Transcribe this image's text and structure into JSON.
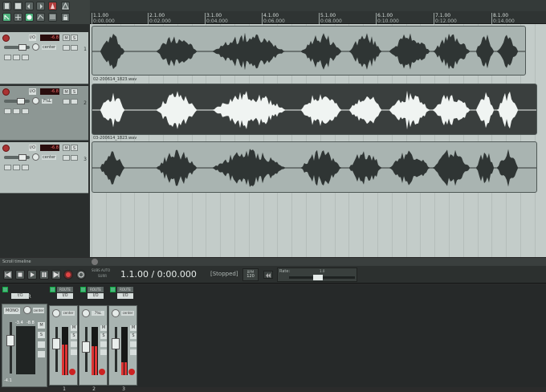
{
  "toolbar": {
    "icons": [
      "new-project-icon",
      "save-icon",
      "undo-icon",
      "redo-icon",
      "metronome-icon",
      "snap-icon",
      "ripple-icon",
      "grid-icon",
      "record-mode-icon",
      "envelope-icon",
      "lock-icon",
      "auto-crossfade-icon"
    ]
  },
  "ruler": {
    "markers": [
      {
        "bar": "1.1.00",
        "time": "0:00.000"
      },
      {
        "bar": "2.1.00",
        "time": "0:02.000"
      },
      {
        "bar": "3.1.00",
        "time": "0:04.000"
      },
      {
        "bar": "4.1.00",
        "time": "0:06.000"
      },
      {
        "bar": "5.1.00",
        "time": "0:08.000"
      },
      {
        "bar": "6.1.00",
        "time": "0:10.000"
      },
      {
        "bar": "7.1.00",
        "time": "0:12.000"
      },
      {
        "bar": "8.1.00",
        "time": "0:14.000"
      }
    ]
  },
  "tracks": [
    {
      "number": "1",
      "io": "I/O",
      "peak": "-6.8",
      "pan": "center",
      "item_name": "",
      "selected": false
    },
    {
      "number": "2",
      "io": "I/O",
      "peak": "-6.8",
      "pan": "7%L",
      "item_name": "02-200614_1823.wav",
      "selected": true
    },
    {
      "number": "3",
      "io": "I/O",
      "peak": "-6.8",
      "pan": "center",
      "item_name": "03-200614_1823.wav",
      "selected": false
    }
  ],
  "track_buttons": {
    "mute": "M",
    "solo": "S"
  },
  "scroll_label": "Scroll timeline",
  "transport": {
    "position": "1.1.00 / 0:00.000",
    "state": "[Stopped]",
    "bpm_label": "BPM",
    "bpm_value": "120",
    "rate_label": "Rate:",
    "rate_value": "1.0",
    "small_label": "SUBS AUTO",
    "small_sub": "SURR"
  },
  "mixer": {
    "master_label": "MASTER",
    "master_io": "I/O",
    "master_mono": "MONO",
    "master_peak_l": "-3.4",
    "master_peak_r": "-8.8",
    "master_bottom": "-4.1",
    "route_label": "ROUTE",
    "strips": [
      {
        "number": "1",
        "io": "I/O",
        "pan": "center"
      },
      {
        "number": "2",
        "io": "I/O",
        "pan": "7%L"
      },
      {
        "number": "3",
        "io": "I/O",
        "pan": "center"
      }
    ]
  },
  "colors": {
    "accent_green": "#4fb37e",
    "record_red": "#b03c3c",
    "arrange_bg": "#c3ccc9",
    "item_selected": "#3a3f3e"
  }
}
